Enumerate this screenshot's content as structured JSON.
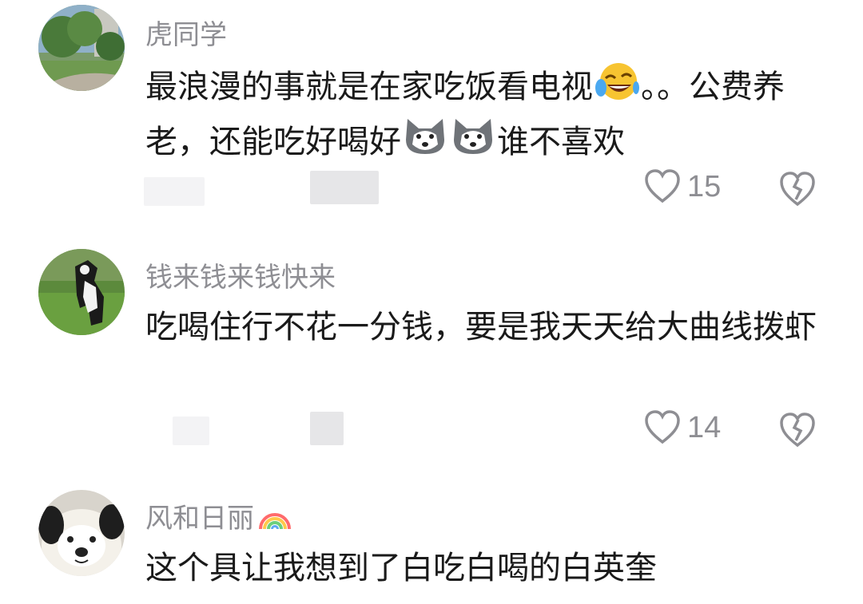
{
  "comments": [
    {
      "username": "虎同学",
      "text_parts": [
        "最浪漫的事就是在家吃饭看电视",
        "。。公费养老，还能吃好喝好",
        "谁不喜欢"
      ],
      "emojis": [
        "laughing-crying-emoji",
        "husky-dog-emoji",
        "husky-dog-emoji"
      ],
      "likes": "15"
    },
    {
      "username": "钱来钱来钱快来",
      "text": "吃喝住行不花一分钱，要是我天天给大曲线拨虾",
      "likes": "14"
    },
    {
      "username": "风和日丽",
      "username_emoji": "rainbow-emoji",
      "text": "这个具让我想到了白吃白喝的白英奎"
    }
  ],
  "icons": {
    "like": "heart-outline-icon",
    "dislike": "broken-heart-icon"
  },
  "colors": {
    "username": "#8e8e93",
    "text": "#1a1a1a",
    "icon": "#8e8e93"
  }
}
